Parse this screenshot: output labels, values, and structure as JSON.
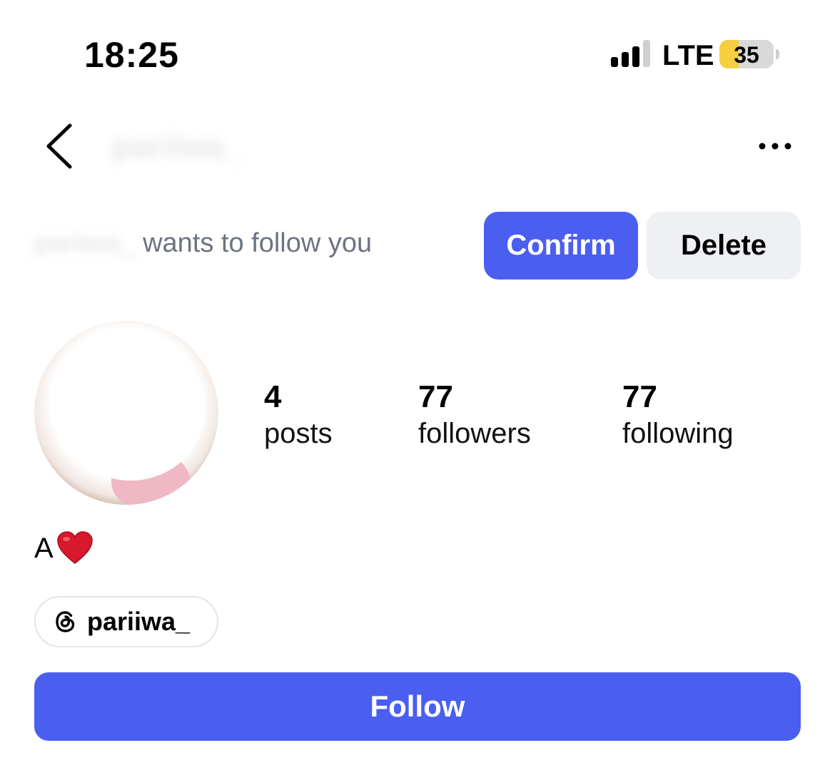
{
  "status_bar": {
    "time": "18:25",
    "network": "LTE",
    "battery": "35",
    "battery_level": 0.35,
    "battery_color": "#f5cf3f"
  },
  "nav": {
    "back_icon": "chevron-left-icon",
    "title": "pariiwa_",
    "more_icon": "ellipsis-icon"
  },
  "request": {
    "username": "pariiwa_",
    "text": " wants to follow you",
    "confirm_label": "Confirm",
    "delete_label": "Delete"
  },
  "profile": {
    "stats": {
      "posts": {
        "count": "4",
        "label": "posts"
      },
      "followers": {
        "count": "77",
        "label": "followers"
      },
      "following": {
        "count": "77",
        "label": "following"
      }
    },
    "bio": "A",
    "bio_emoji": "heart-icon",
    "threads": {
      "icon": "threads-icon",
      "handle": "pariiwa_"
    },
    "follow_label": "Follow"
  },
  "colors": {
    "accent": "#4a5ff0",
    "secondary_button": "#eff0f3",
    "muted_text": "#6d7380"
  }
}
